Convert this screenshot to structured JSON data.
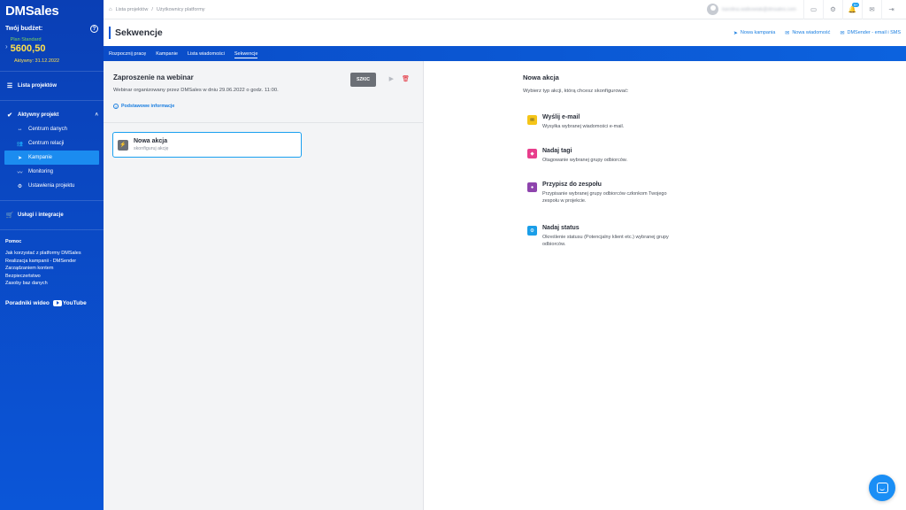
{
  "sidebar": {
    "logo": "DMSales",
    "budget": {
      "title": "Twój budżet:",
      "plan": "Plan Standard",
      "amount": "5600,50",
      "valid": "Aktywny: 31.12.2022"
    },
    "projects_label": "Lista projektów",
    "active_project_label": "Aktywny projekt",
    "sub_items": [
      {
        "label": "Centrum danych",
        "icon": "data-center-icon"
      },
      {
        "label": "Centrum relacji",
        "icon": "users-icon"
      },
      {
        "label": "Kampanie",
        "icon": "paper-plane-icon"
      },
      {
        "label": "Monitoring",
        "icon": "chart-line-icon"
      },
      {
        "label": "Ustawienia projektu",
        "icon": "gear-icon"
      }
    ],
    "services_label": "Usługi i integracje",
    "help": {
      "title": "Pomoc",
      "links": [
        "Jak korzystać z platformy DMSales",
        "Realizacja kampanii - DMSender",
        "Zarządzaniem kontem",
        "Bezpieczeństwo",
        "Zasoby baz danych"
      ]
    },
    "video_label": "Poradniki wideo",
    "youtube_label": "YouTube"
  },
  "topbar": {
    "breadcrumb": [
      "Lista projektów",
      "Użytkownicy platformy"
    ],
    "user_email": "karolina.walkowiak@dmsales.com",
    "notification_count": "9+"
  },
  "page": {
    "title": "Sekwencje",
    "actions": [
      "Nowa kampania",
      "Nowa wiadomość",
      "DMSender - email i SMS"
    ]
  },
  "tabs": [
    "Rozpocznij pracę",
    "Kampanie",
    "Lista wiadomości",
    "Sekwencje"
  ],
  "campaign": {
    "title": "Zaproszenie na webinar",
    "description": "Webinar organizowany przez DMSales w dniu 29.06.2022 o godz. 11:00.",
    "info_link": "Podstawowe informacje",
    "status": "SZKIC"
  },
  "action_card": {
    "title": "Nowa akcja",
    "subtitle": "skonfiguruj akcję"
  },
  "new_action": {
    "title": "Nowa akcja",
    "subtitle": "Wybierz typ akcji, którą chcesz skonfigurować:",
    "options": [
      {
        "title": "Wyślij e-mail",
        "desc": "Wysyłka wybranej wiadomości e-mail.",
        "color": "#f5c518",
        "icon": "envelope-icon"
      },
      {
        "title": "Nadaj tagi",
        "desc": "Otagowanie wybranej grupy odbiorców.",
        "color": "#e83e8c",
        "icon": "tag-icon"
      },
      {
        "title": "Przypisz do zespołu",
        "desc": "Przypisanie wybranej grupy odbiorców członkom Twojego zespołu w projekcie.",
        "color": "#8e44ad",
        "icon": "user-icon"
      },
      {
        "title": "Nadaj status",
        "desc": "Określenie statusu (Potencjalny klient etc.) wybranej grupy odbiorców.",
        "color": "#1a9ee8",
        "icon": "status-icon"
      }
    ]
  }
}
